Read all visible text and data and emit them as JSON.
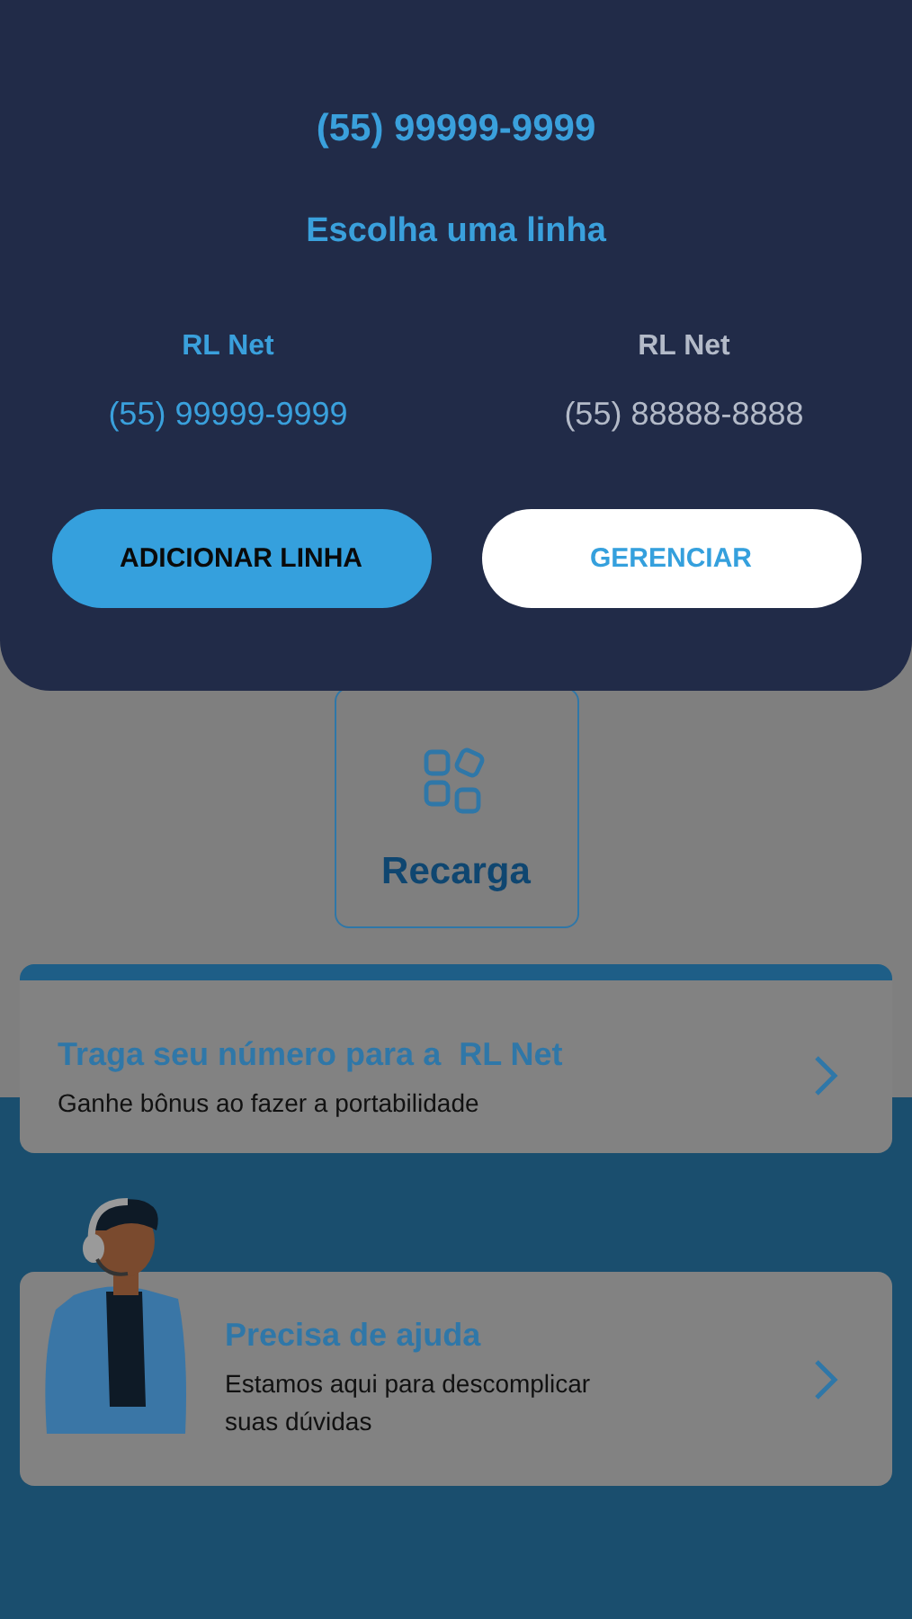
{
  "header": {
    "phone": "(55) 99999-9999",
    "title": "Escolha uma linha"
  },
  "lines": [
    {
      "operator": "RL Net",
      "number": "(55) 99999-9999",
      "selected": true
    },
    {
      "operator": "RL Net",
      "number": "(55) 88888-8888",
      "selected": false
    }
  ],
  "buttons": [
    {
      "label": "ADICIONAR LINHA",
      "kind": "primary"
    },
    {
      "label": "GERENCIAR",
      "kind": "secondary"
    }
  ],
  "shortcut": {
    "label": "Recarga"
  },
  "promo": {
    "title": "Traga seu número para a  RL Net",
    "subtitle": "Ganhe bônus ao fazer a portabilidade"
  },
  "help": {
    "title": "Precisa de ajuda",
    "subtitle": "Estamos aqui para descomplicar suas dúvidas"
  }
}
